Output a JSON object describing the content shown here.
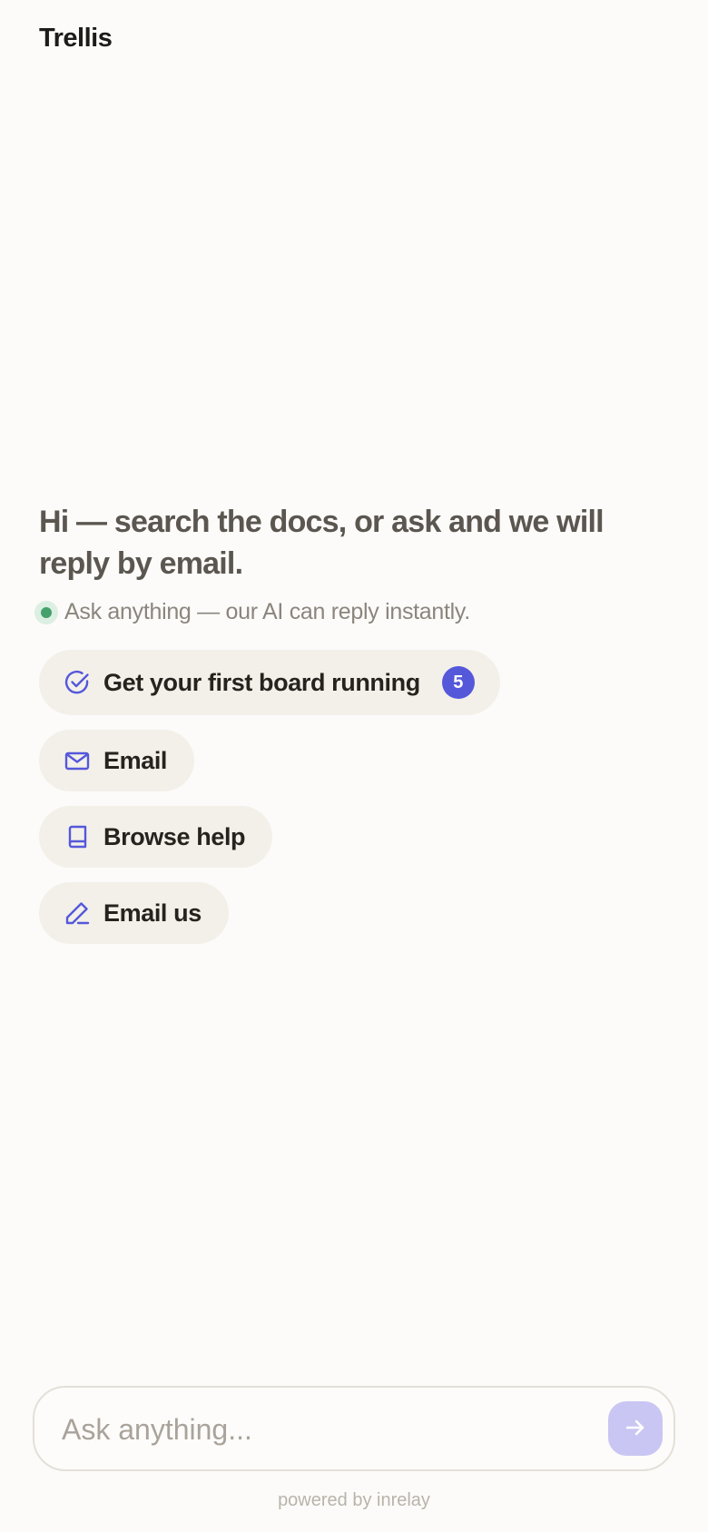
{
  "header": {
    "brand": "Trellis"
  },
  "hero": {
    "headline": "Hi — search the docs, or ask and we will reply by email.",
    "status_text": "Ask anything — our AI can reply instantly."
  },
  "actions": [
    {
      "label": "Get your first board running",
      "icon": "checklist-circle-icon",
      "badge": "5"
    },
    {
      "label": "Email",
      "icon": "mail-icon"
    },
    {
      "label": "Browse help",
      "icon": "book-icon"
    },
    {
      "label": "Email us",
      "icon": "pen-icon"
    }
  ],
  "composer": {
    "placeholder": "Ask anything...",
    "send_icon": "arrow-right-icon"
  },
  "footer": {
    "text": "powered by inrelay"
  },
  "colors": {
    "background": "#fcfbf9",
    "accent": "#5558d9",
    "status_green": "#45a16b",
    "pill_background": "#f3f0ea",
    "send_button": "#c9c6f3"
  }
}
